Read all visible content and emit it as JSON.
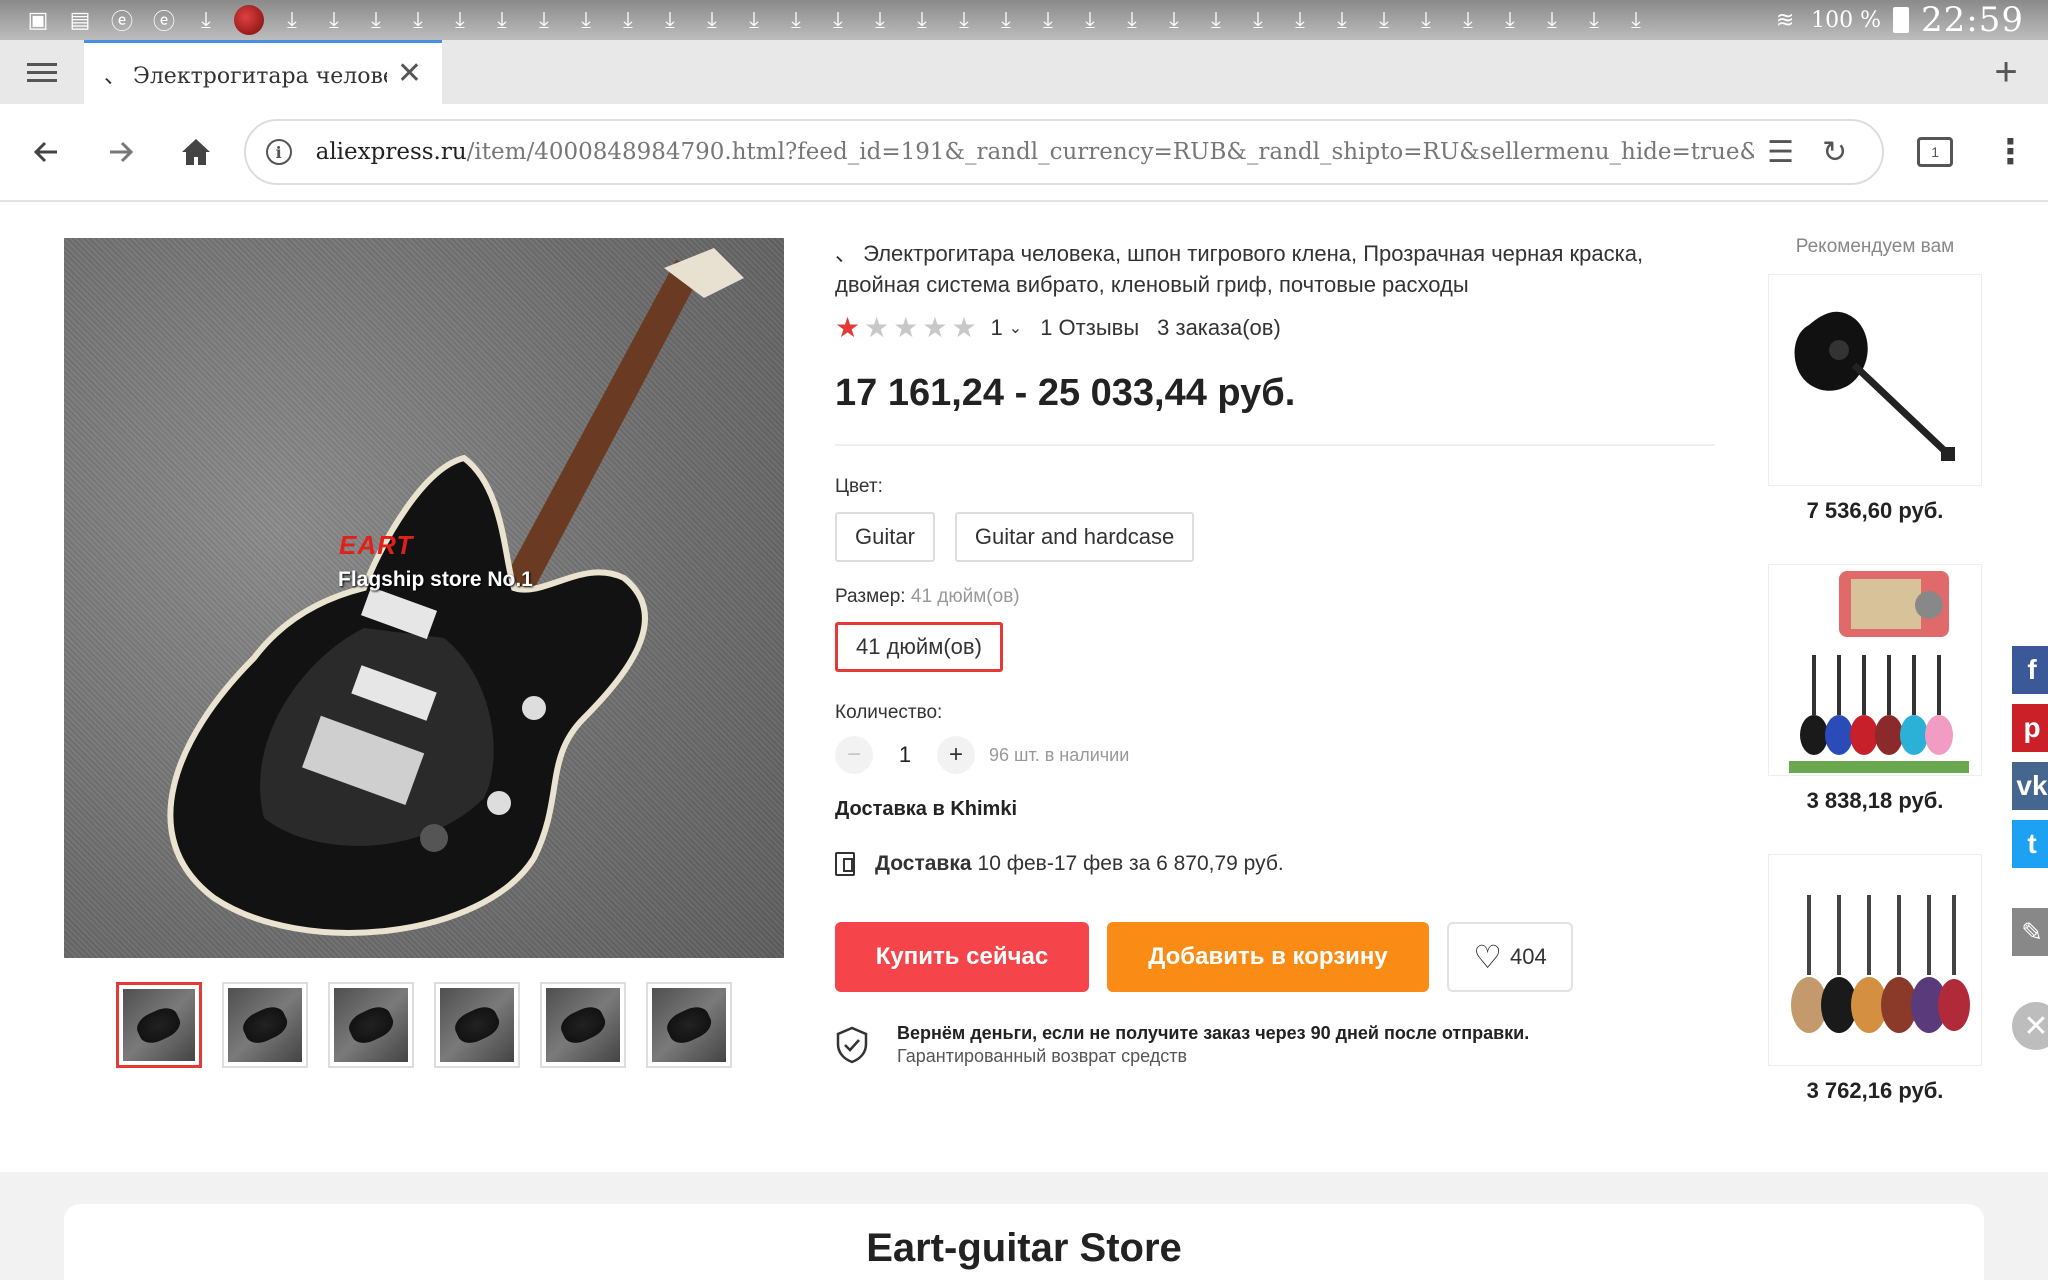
{
  "status_bar": {
    "battery": "100 %",
    "time": "22:59"
  },
  "browser": {
    "tab_title": "、 Электрогитара человека",
    "url_host": "aliexpress.ru",
    "url_path": "/item/4000848984790.html?feed_id=191&_randl_currency=RUB&_randl_shipto=RU&sellermenu_hide=true&src=google"
  },
  "product": {
    "image_brand_red": "EART",
    "image_brand_white": "Flagship store No.1",
    "title": "、 Электрогитара человека, шпон тигрового клена, Прозрачная черная краска, двойная система вибрато, кленовый гриф, почтовые расходы",
    "rating": 1,
    "rating_value": "1",
    "reviews": "1 Отзывы",
    "orders": "3 заказа(ов)",
    "price": "17 161,24 - 25 033,44 руб.",
    "color_label": "Цвет:",
    "color_options": [
      "Guitar",
      "Guitar and hardcase"
    ],
    "size_label": "Размер:",
    "size_selected_text": "41 дюйм(ов)",
    "size_options": [
      "41 дюйм(ов)"
    ],
    "quantity_label": "Количество:",
    "quantity": "1",
    "stock": "96 шт. в наличии",
    "ship_to": "Доставка в Khimki",
    "delivery_label": "Доставка",
    "delivery_text": "10 фев-17 фев за 6 870,79 руб.",
    "buy_now": "Купить сейчас",
    "add_to_cart": "Добавить в корзину",
    "wishlist_count": "404",
    "guarantee_title": "Вернём деньги, если не получите заказ через 90 дней после отправки.",
    "guarantee_sub": "Гарантированный возврат средств"
  },
  "recommended": {
    "title": "Рекомендуем вам",
    "items": [
      {
        "price": "7 536,60 руб."
      },
      {
        "price": "3 838,18 руб."
      },
      {
        "price": "3 762,16 руб."
      }
    ]
  },
  "store": {
    "name": "Eart-guitar Store"
  },
  "colors": {
    "accent_red": "#f5444a",
    "accent_orange": "#fa8c16",
    "selected_border": "#e53935"
  }
}
